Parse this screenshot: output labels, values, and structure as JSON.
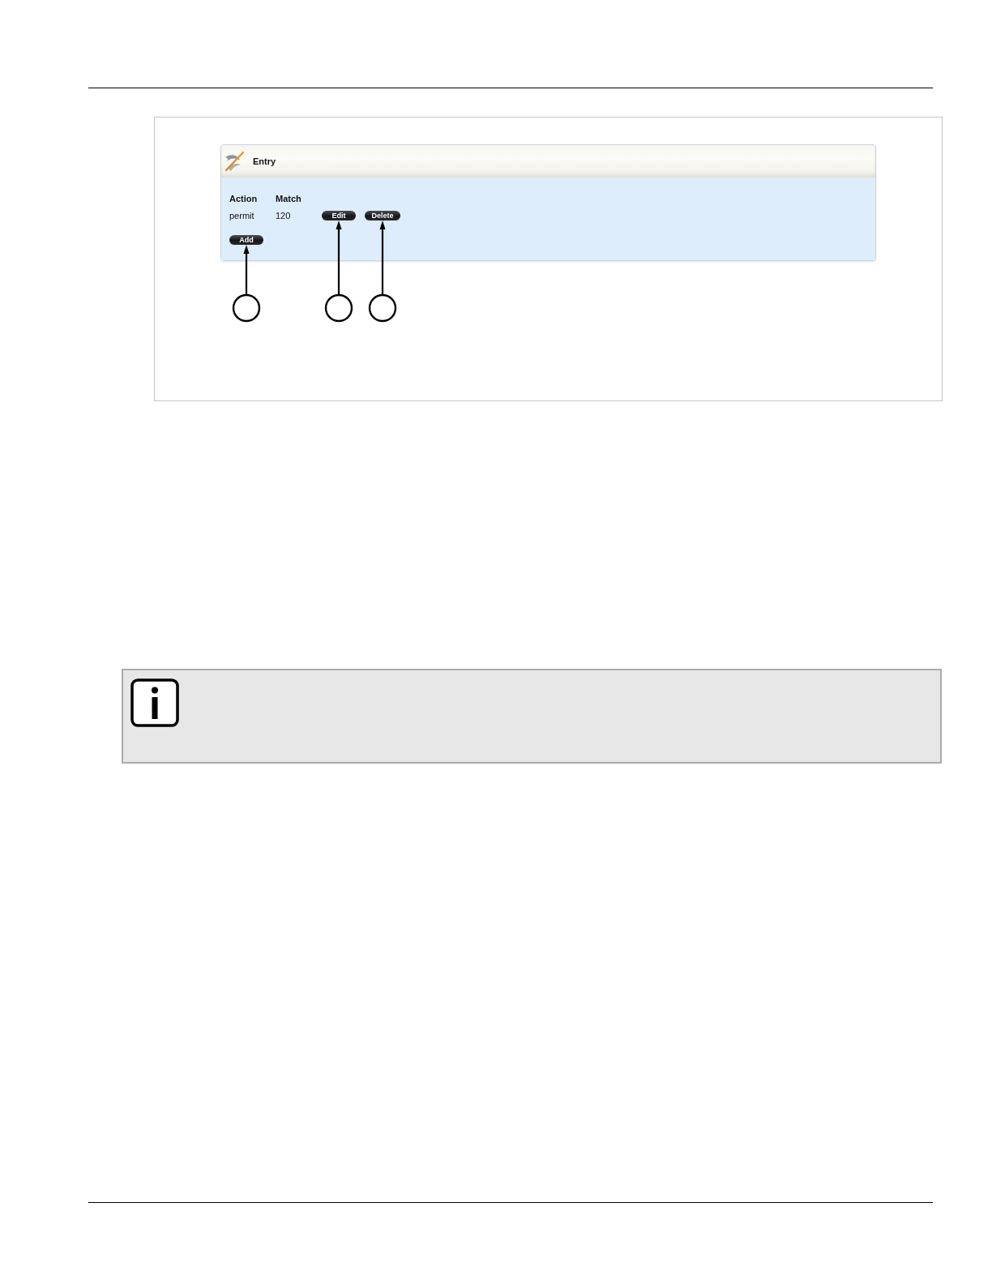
{
  "panel": {
    "title": "Entry",
    "columns": [
      "Action",
      "Match"
    ],
    "rows": [
      {
        "cells": [
          "permit",
          "120"
        ],
        "actions": [
          "Edit",
          "Delete"
        ]
      }
    ],
    "add_button": "Add"
  }
}
